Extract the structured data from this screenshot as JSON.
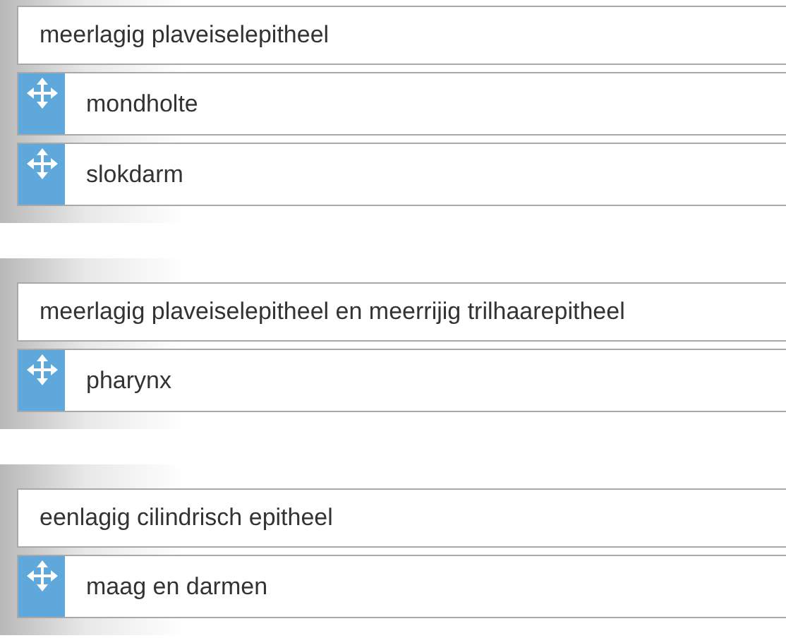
{
  "groups": [
    {
      "heading": "meerlagig plaveiselepitheel",
      "items": [
        {
          "label": "mondholte"
        },
        {
          "label": "slokdarm"
        }
      ]
    },
    {
      "heading": "meerlagig plaveiselepitheel en meerrijig trilhaarepitheel",
      "items": [
        {
          "label": "pharynx"
        }
      ]
    },
    {
      "heading": "eenlagig cilindrisch epitheel",
      "items": [
        {
          "label": "maag en darmen"
        }
      ]
    }
  ]
}
